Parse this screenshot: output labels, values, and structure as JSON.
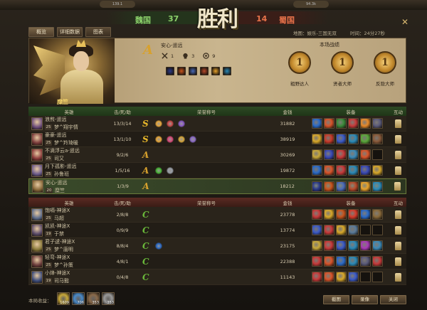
{
  "header": {
    "left_tag": "139.1",
    "right_tag": "94.3k",
    "title": "胜利",
    "team_left": {
      "name": "魏国",
      "score": "37"
    },
    "team_right": {
      "score": "14",
      "name": "蜀国"
    }
  },
  "tabs": [
    {
      "label": "概览"
    },
    {
      "label": "详细数据"
    },
    {
      "label": "图表"
    }
  ],
  "meta": {
    "map": "地图：娱乐-三国无双",
    "time": "时间：24分27秒"
  },
  "banner": {
    "rank": "A",
    "player": "安心-遥远",
    "kills": "1",
    "deaths": "3",
    "assists": "9",
    "hero_name": "糜竺",
    "battle_title": "本场战绩",
    "medals": [
      {
        "label": "粗野达人"
      },
      {
        "label": "贤者大师"
      },
      {
        "label": "反隐大师"
      }
    ],
    "equip_colors": [
      "#2a3a8a",
      "#c8541c",
      "#4a6ab8",
      "#b84a2a",
      "#e8a22a",
      "#2a8ab8"
    ]
  },
  "columns": {
    "hero": "英雄",
    "kda": "击/死/助",
    "titles": "荣誉称号",
    "gold": "金钱",
    "equip": "装备",
    "interact": "互动"
  },
  "team_wei": [
    {
      "level": "25",
      "name": "浪煎-遥远",
      "sub": "梦^翔宇情",
      "kda": "13/3/14",
      "rank": "S",
      "rank_color": "#e8b82a",
      "gold": "31882",
      "avatar": "#6a4a7a",
      "titles": [
        "#e8a83a",
        "#c84a4a",
        "#8a5ac8"
      ],
      "equip": [
        "#2a6ac8",
        "#d8542a",
        "#3a8a3a",
        "#c83a3a",
        "#e88a2a",
        "#5a5a7a"
      ]
    },
    {
      "level": "25",
      "name": "豪豪-遥远",
      "sub": "梦^羚琦暖",
      "kda": "13/1/10",
      "rank": "S",
      "rank_color": "#e8b82a",
      "gold": "38919",
      "avatar": "#7a3a3a",
      "titles": [
        "#e8a83a",
        "#d84a7a",
        "#d8a83a",
        "#8a6ac8"
      ],
      "equip": [
        "#d8a82a",
        "#c83a2a",
        "#3a5ac8",
        "#2a8ab8",
        "#5aa83a",
        "#8a5a3a"
      ]
    },
    {
      "level": "25",
      "name": "不滴浮云a-遥远",
      "sub": "司又",
      "kda": "9/2/6",
      "rank": "A",
      "rank_color": "#d7a12d",
      "gold": "30269",
      "avatar": "#8a3a3a",
      "titles": [],
      "equip": [
        "#c8a83a",
        "#3a4ab8",
        "#c83a3a",
        "#3a8ab8",
        "#d8542a",
        "#1e1a14"
      ]
    },
    {
      "level": "25",
      "name": "月下孤影-遥远",
      "sub": "孙鲁班",
      "kda": "1/5/16",
      "rank": "A",
      "rank_color": "#d7a12d",
      "gold": "19872",
      "avatar": "#6a5a8a",
      "titles": [
        "#4ab83a",
        "#9aa0a8"
      ],
      "equip": [
        "#2a6ac8",
        "#d8542a",
        "#c83a3a",
        "#2a8ab8",
        "#3a4ab8",
        "#d8a82a"
      ]
    },
    {
      "level": "20",
      "name": "安心-遥远",
      "sub": "糜竺",
      "kda": "1/3/9",
      "rank": "A",
      "rank_color": "#d7a12d",
      "gold": "18212",
      "avatar": "#8a6a3a",
      "self": true,
      "titles": [],
      "equip": [
        "#2a3a8a",
        "#c8541c",
        "#4a6ab8",
        "#b84a2a",
        "#e8a22a",
        "#2a8ab8"
      ]
    }
  ],
  "team_shu": [
    {
      "level": "25",
      "name": "饱嗝-神途X",
      "sub": "马超",
      "kda": "2/8/8",
      "rank": "C",
      "rank_color": "#6ab83a",
      "gold": "23778",
      "avatar": "#5a6a8a",
      "titles": [],
      "equip": [
        "#c83a3a",
        "#d8a82a",
        "#c8541c",
        "#d83a2a",
        "#2a6ac8",
        "#8a6a3a"
      ]
    },
    {
      "level": "19",
      "name": "凯凯-神途X",
      "sub": "于禁",
      "kda": "0/9/9",
      "rank": "C",
      "rank_color": "#6ab83a",
      "gold": "13774",
      "avatar": "#5a4a6a",
      "titles": [],
      "equip": [
        "#3a5ac8",
        "#c83a3a",
        "#d8a82a",
        "#5a7a9a",
        "#1e1a14",
        "#1e1a14"
      ]
    },
    {
      "level": "25",
      "name": "君子逑-神途X",
      "sub": "梦^唐明",
      "kda": "8/8/4",
      "rank": "C",
      "rank_color": "#6ab83a",
      "gold": "23175",
      "avatar": "#8a7a3a",
      "titles": [
        "#2a6ac8"
      ],
      "equip": [
        "#c8a83a",
        "#c83a3a",
        "#3a5ac8",
        "#2a8ab8",
        "#a83ab8",
        "#3a8ab8"
      ]
    },
    {
      "level": "25",
      "name": "轻弯-神途X",
      "sub": "梦^孙策",
      "kda": "4/8/1",
      "rank": "C",
      "rank_color": "#6ab83a",
      "gold": "22388",
      "avatar": "#6a3a3a",
      "titles": [],
      "equip": [
        "#c83a3a",
        "#d8542a",
        "#2a6ac8",
        "#2a8ab8",
        "#5a5a7a",
        "#c83a3a"
      ]
    },
    {
      "level": "19",
      "name": "小烽-神途X",
      "sub": "司马懿",
      "kda": "0/4/8",
      "rank": "C",
      "rank_color": "#6ab83a",
      "gold": "11143",
      "avatar": "#3a4a7a",
      "titles": [],
      "equip": [
        "#c83a3a",
        "#d8542a",
        "#d8a82a",
        "#3a5ac8",
        "#1e1a14",
        "#1e1a14"
      ]
    }
  ],
  "bottom": {
    "income_label": "本局收益：",
    "income": [
      {
        "value": "1609",
        "color": "#c8a83a"
      },
      {
        "value": "706",
        "color": "#4a8ac8"
      },
      {
        "value": "353",
        "color": "#8a6a4a"
      },
      {
        "value": "353",
        "color": "#9a9a9a"
      }
    ],
    "buttons": [
      {
        "label": "截图"
      },
      {
        "label": "录像"
      },
      {
        "label": "关闭"
      }
    ]
  }
}
